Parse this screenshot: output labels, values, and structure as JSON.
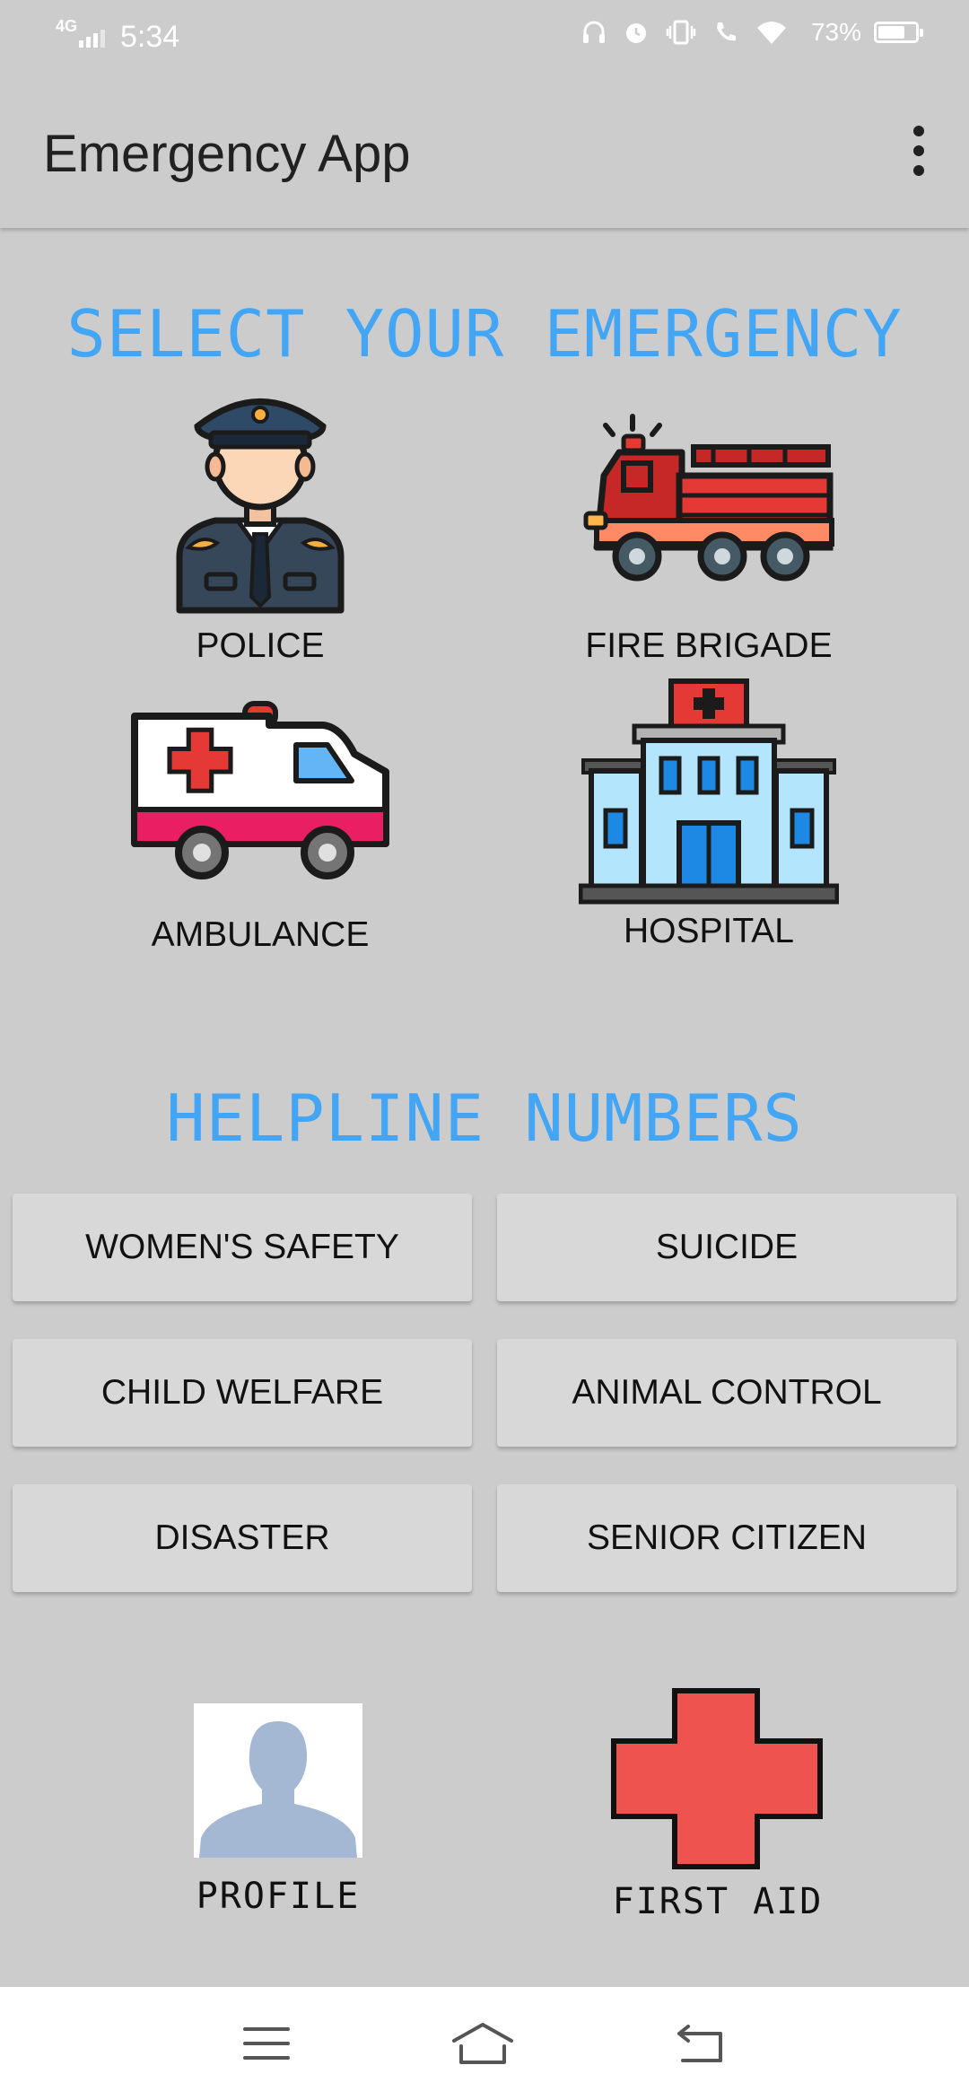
{
  "status_bar": {
    "network": "4G",
    "time": "5:34",
    "battery_percent": "73%",
    "battery_level": 0.73
  },
  "app_bar": {
    "title": "Emergency App",
    "overflow_icon": "more-vert-icon"
  },
  "emergency": {
    "heading": "SELECT YOUR EMERGENCY",
    "items": [
      {
        "label": "POLICE",
        "icon": "police-officer-icon"
      },
      {
        "label": "FIRE BRIGADE",
        "icon": "fire-truck-icon"
      },
      {
        "label": "AMBULANCE",
        "icon": "ambulance-icon"
      },
      {
        "label": "HOSPITAL",
        "icon": "hospital-icon"
      }
    ]
  },
  "helpline": {
    "heading": "HELPLINE NUMBERS",
    "buttons": [
      {
        "label": "WOMEN'S SAFETY"
      },
      {
        "label": "SUICIDE"
      },
      {
        "label": "CHILD WELFARE"
      },
      {
        "label": "ANIMAL CONTROL"
      },
      {
        "label": "DISASTER"
      },
      {
        "label": "SENIOR CITIZEN"
      }
    ]
  },
  "bottom": {
    "profile_label": "PROFILE",
    "first_aid_label": "FIRST AID"
  },
  "colors": {
    "accent": "#42a5f5",
    "background": "#cccccc",
    "button": "#d8d8d8",
    "first_aid_red": "#ef5350"
  }
}
